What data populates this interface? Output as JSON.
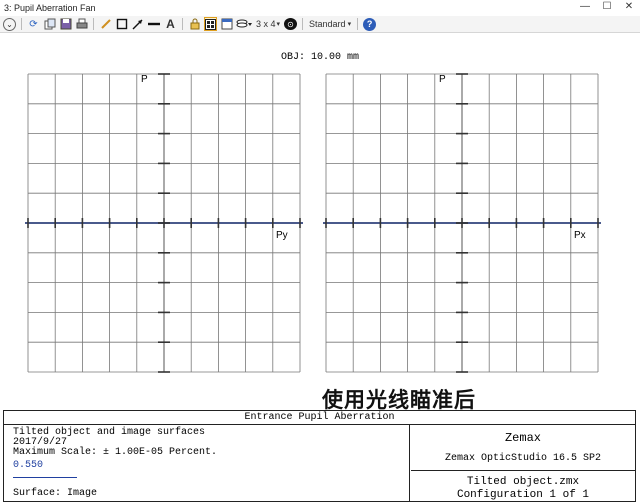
{
  "window": {
    "title": "3: Pupil Aberration Fan",
    "controls": [
      "—",
      "☐",
      "✕"
    ]
  },
  "toolbar": {
    "grid_label": "3 x 4",
    "style_label": "Standard",
    "help_label": "?",
    "text_tool_label": "A",
    "icons": [
      "settings-dropdown-icon",
      "refresh-icon",
      "copy-icon",
      "save-icon",
      "print-icon",
      "pencil-icon",
      "rectangle-icon",
      "arrow-icon",
      "line-icon",
      "text-icon",
      "lock-icon",
      "layout-icon",
      "window-icon",
      "layers-icon",
      "grid-icon",
      "zemax-icon",
      "style-dropdown-icon",
      "help-icon"
    ]
  },
  "plot": {
    "obj_label": "OBJ: 10.00 mm",
    "fans": [
      {
        "vertical_label": "P",
        "horizontal_label": "Py"
      },
      {
        "vertical_label": "P",
        "horizontal_label": "Px"
      }
    ],
    "axis_color": "#4a5a8c",
    "grid_color": "#777777"
  },
  "overlay_text": "使用光线瞄准后",
  "info": {
    "header": "Entrance Pupil Aberration",
    "line1": "Tilted object and image surfaces",
    "line2": "2017/9/27",
    "line3": "Maximum Scale: ± 1.00E-05 Percent.",
    "wavelength": "0.550",
    "wavelength_color": "#2040a0",
    "surface": "Surface: Image",
    "brand": "Zemax",
    "version": "Zemax OpticStudio 16.5 SP2",
    "file": "Tilted object.zmx",
    "config": "Configuration 1 of 1"
  }
}
